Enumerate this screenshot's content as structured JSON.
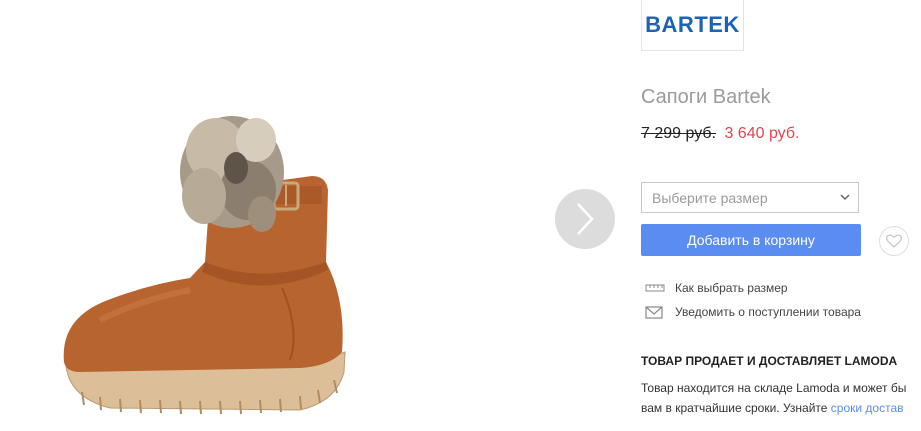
{
  "brand": {
    "logo_text": "BARTEK"
  },
  "product": {
    "title": "Сапоги Bartek",
    "old_price": "7 299 руб.",
    "new_price": "3 640 руб."
  },
  "size_select": {
    "placeholder": "Выберите размер"
  },
  "cart": {
    "add_label": "Добавить в корзину"
  },
  "links": {
    "size_guide": "Как выбрать размер",
    "notify": "Уведомить о поступлении товара"
  },
  "seller": {
    "heading": "ТОВАР ПРОДАЕТ И ДОСТАВЛЯЕТ LAMODA",
    "line1": "Товар находится на складе Lamoda и может бы",
    "line2_prefix": "вам в кратчайшие сроки. Узнайте ",
    "line2_link": "сроки достав"
  },
  "icons": {
    "next": "chevron-right-icon",
    "dropdown": "chevron-down-icon",
    "wishlist": "heart-icon",
    "size_guide": "ruler-icon",
    "notify": "envelope-icon"
  },
  "colors": {
    "accent": "#5b8cf0",
    "sale_price": "#e54550",
    "brand_logo": "#1b63b5"
  }
}
